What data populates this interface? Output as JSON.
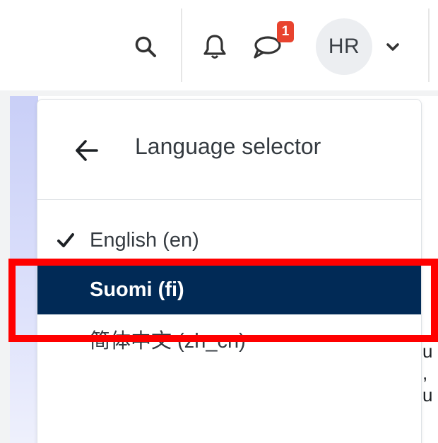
{
  "navbar": {
    "search_icon": "search-icon",
    "notifications_icon": "bell-icon",
    "messages_icon": "chat-icon",
    "messages_badge": "1",
    "user_initials": "HR",
    "user_menu_icon": "chevron-down-icon"
  },
  "page": {
    "snippets": [
      "u ,",
      "u"
    ]
  },
  "language_menu": {
    "title": "Language selector",
    "back_icon": "arrow-left-icon",
    "items": [
      {
        "label": "English (en)",
        "selected": true,
        "icon": "check-icon"
      },
      {
        "label": "Suomi (fi)",
        "selected": false,
        "hovered": true
      },
      {
        "label": "简体中文 (zh_cn)",
        "selected": false
      }
    ]
  },
  "colors": {
    "highlight_outline": "#ff0000",
    "active_item_bg": "#012a56",
    "badge": "#e8432e"
  }
}
